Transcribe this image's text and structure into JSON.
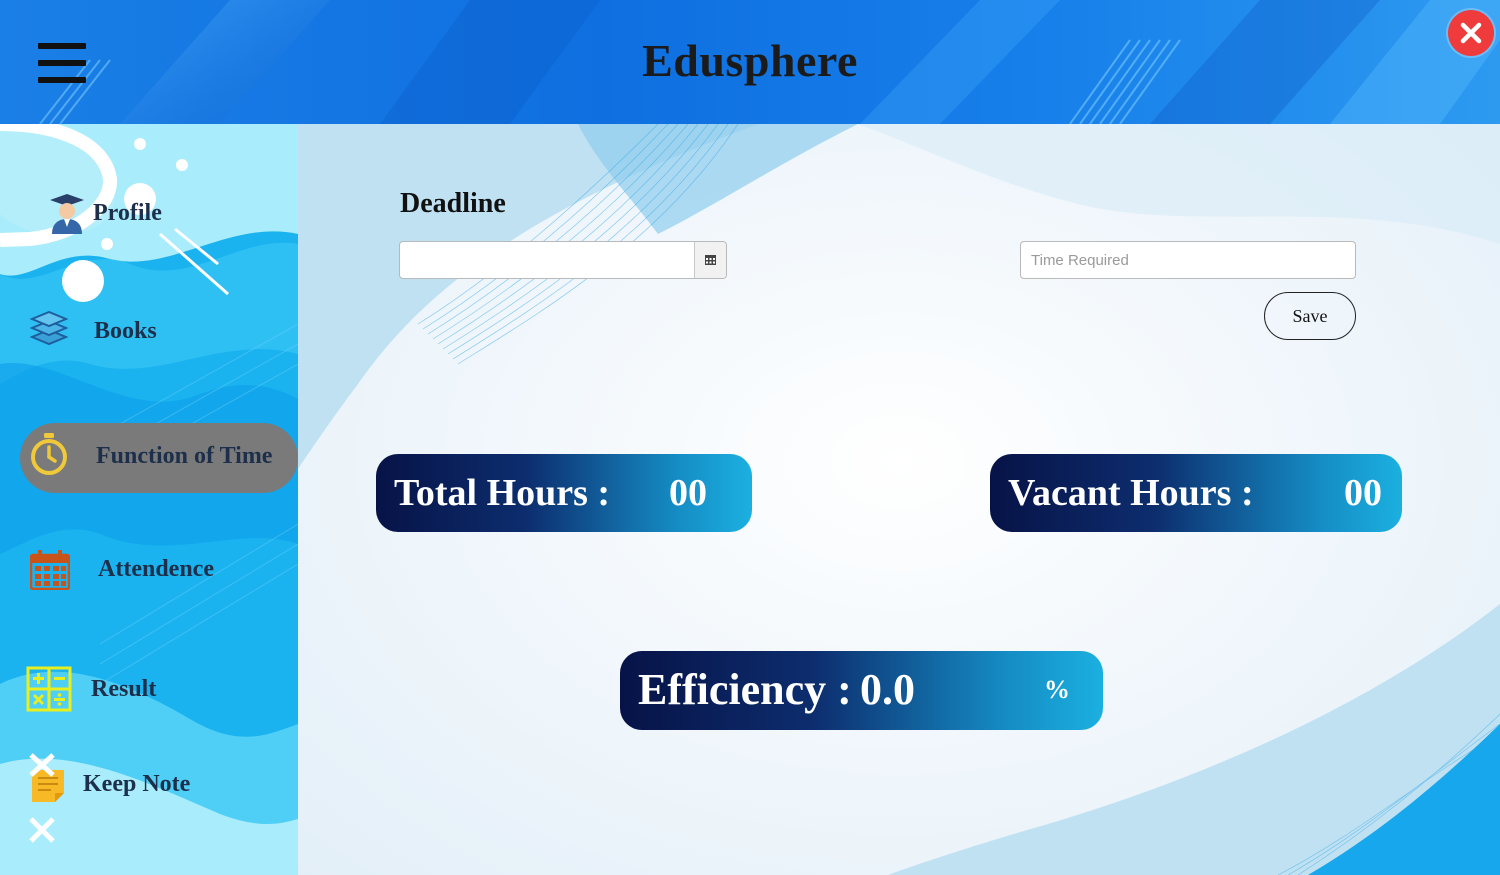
{
  "app": {
    "title": "Edusphere"
  },
  "header": {
    "menu_icon": "hamburger-menu-icon",
    "close_icon": "close-icon"
  },
  "sidebar": {
    "items": [
      {
        "label": "Profile",
        "icon": "graduate-profile-icon",
        "active": false
      },
      {
        "label": "Books",
        "icon": "books-stack-icon",
        "active": false
      },
      {
        "label": "Function of Time",
        "icon": "stopwatch-icon",
        "active": true
      },
      {
        "label": "Attendence",
        "icon": "calendar-icon",
        "active": false
      },
      {
        "label": "Result",
        "icon": "calculator-icon",
        "active": false
      },
      {
        "label": "Keep Note",
        "icon": "sticky-note-icon",
        "active": false
      }
    ]
  },
  "form": {
    "deadline_label": "Deadline",
    "deadline_value": "",
    "time_required_placeholder": "Time Required",
    "save_label": "Save"
  },
  "stats": {
    "total_hours_label": "Total Hours :",
    "total_hours_value": "00",
    "vacant_hours_label": "Vacant Hours :",
    "vacant_hours_value": "00",
    "efficiency_label": "Efficiency :",
    "efficiency_value": "0.0",
    "efficiency_unit": "%"
  },
  "colors": {
    "header_blue": "#1a7fe6",
    "sidebar_blue": "#1ab3f0",
    "active_pill": "#7a7a7a",
    "close_red": "#ef3b3b",
    "stat_dark": "#071347",
    "stat_light": "#1bb0e0"
  }
}
